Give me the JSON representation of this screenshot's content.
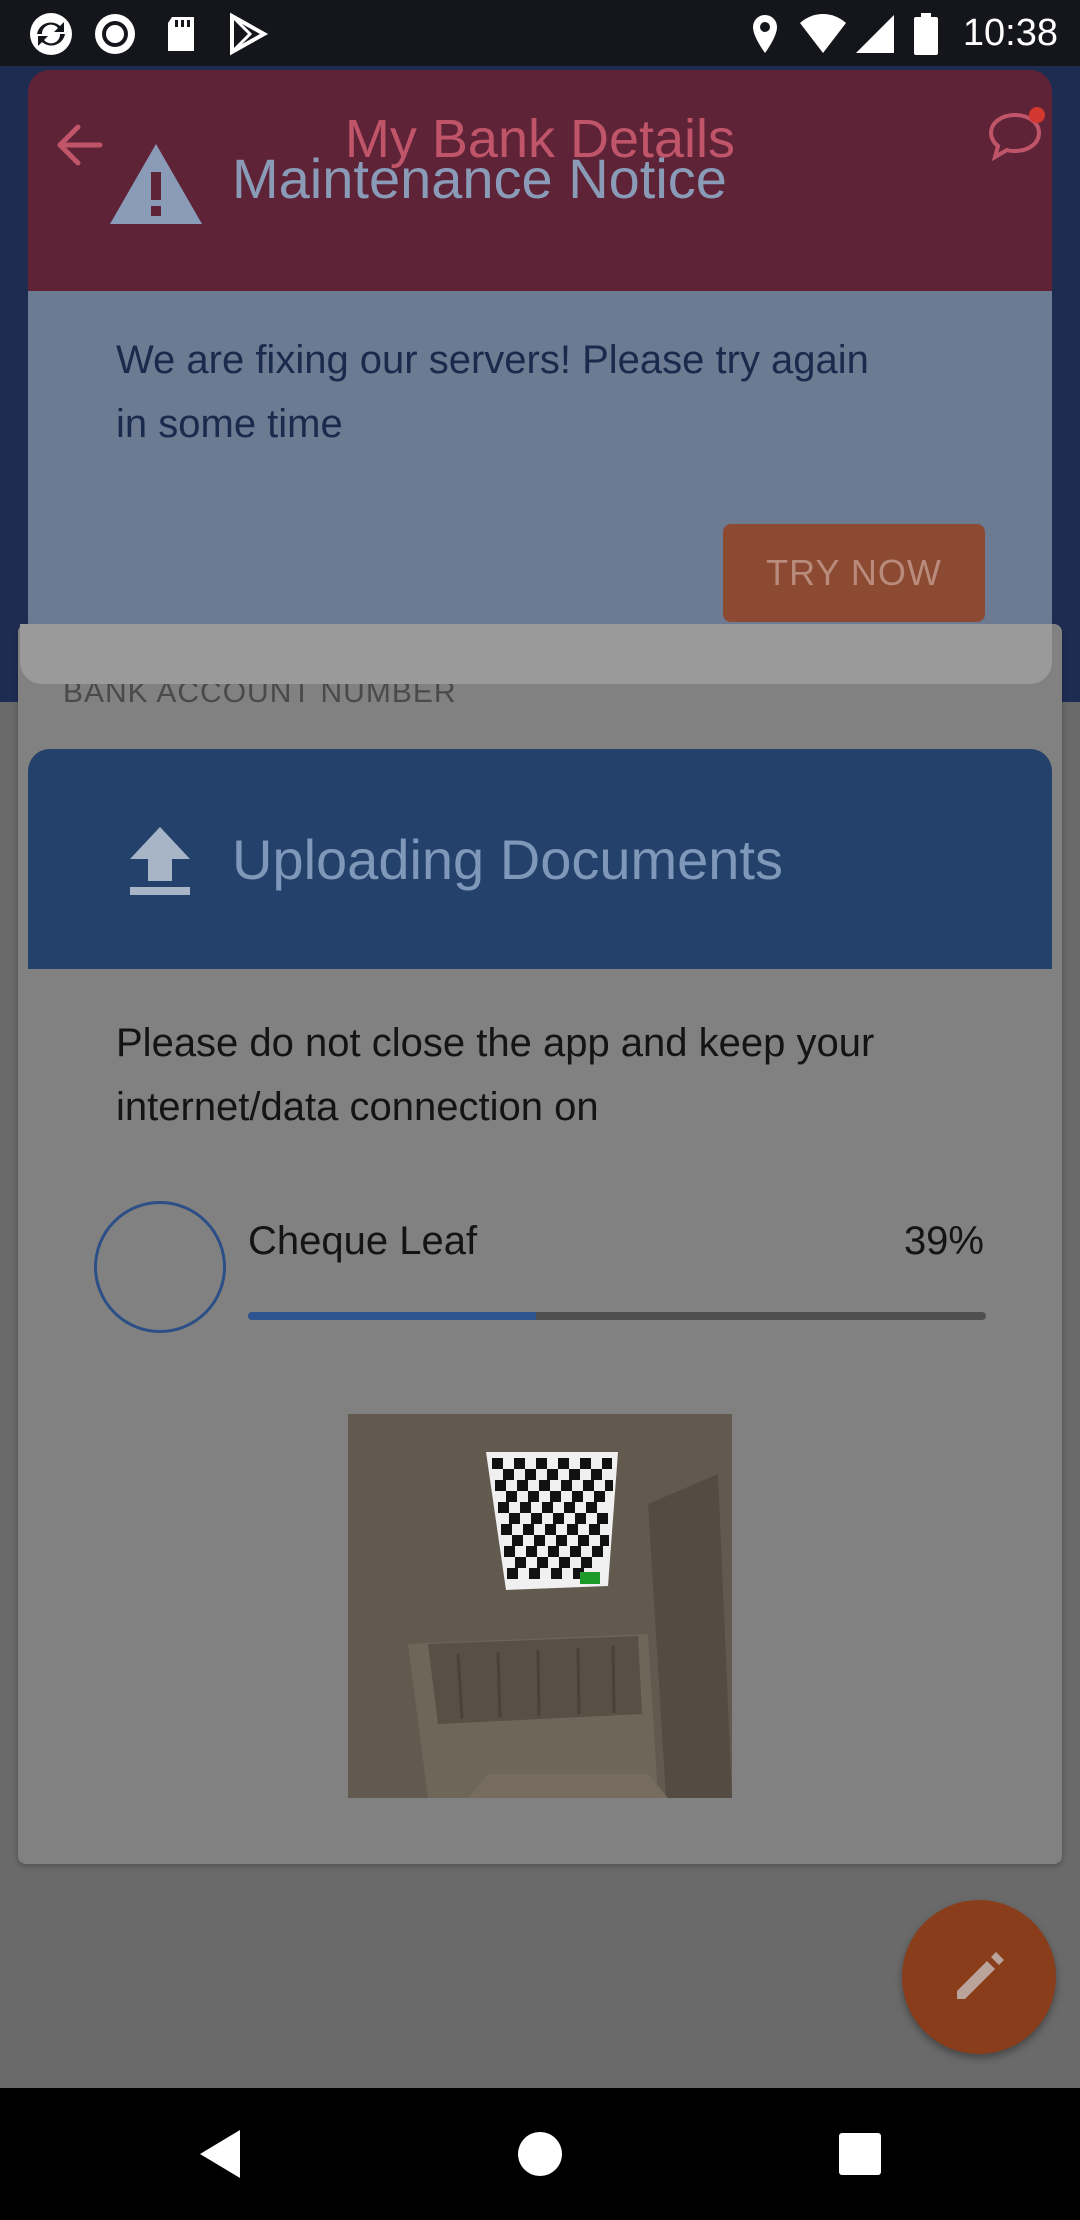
{
  "status_bar": {
    "time": "10:38",
    "left_icons": [
      "sync-icon",
      "record-icon",
      "sd-card-icon",
      "play-store-icon"
    ],
    "right_icons": [
      "location-icon",
      "wifi-icon",
      "signal-icon",
      "battery-icon"
    ]
  },
  "app": {
    "title": "My Bank Details",
    "back_icon": "arrow-left-icon",
    "chat_icon": "chat-bubble-icon",
    "field_label": "BANK ACCOUNT NUMBER"
  },
  "maintenance_dialog": {
    "icon": "warning-icon",
    "title": "Maintenance Notice",
    "message": "We are fixing our servers! Please try again in some time",
    "button_label": "TRY NOW"
  },
  "upload_dialog": {
    "icon": "upload-icon",
    "title": "Uploading Documents",
    "message": "Please do not close the app and keep your internet/data connection on",
    "file_name": "Cheque Leaf",
    "percent_text": "39%",
    "progress": 0.39,
    "preview_alt": "uploaded document preview"
  },
  "fab": {
    "icon": "pencil-icon"
  },
  "nav_bar": {
    "icons": [
      "back-triangle-icon",
      "home-circle-icon",
      "recents-square-icon"
    ]
  },
  "colors": {
    "maintenance_header": "#5e2337",
    "upload_header": "#23416b",
    "progress_fill": "#2f5590",
    "fab": "#8a3d1b"
  }
}
